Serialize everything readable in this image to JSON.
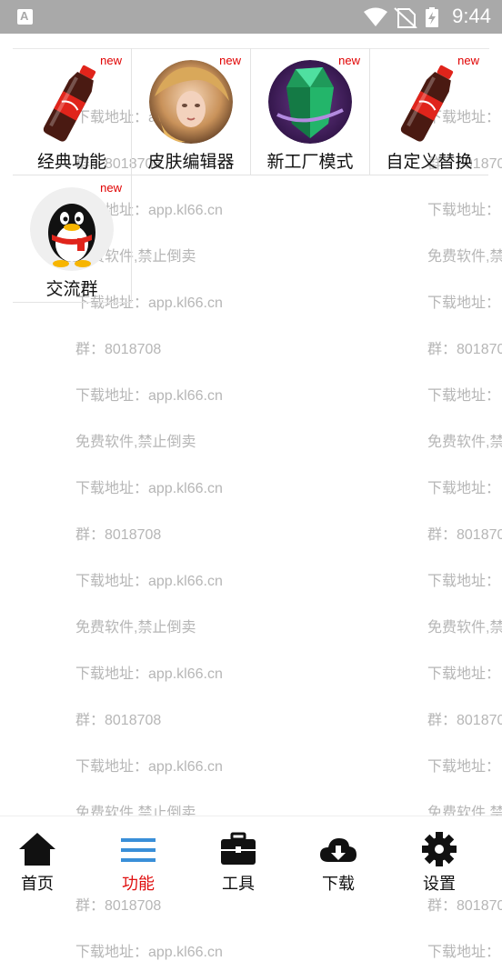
{
  "status_bar": {
    "time": "9:44",
    "icons": [
      "app-launcher-icon",
      "wifi-icon",
      "no-sim-icon",
      "battery-charging-icon"
    ]
  },
  "watermark": {
    "left_texts": [
      "下载地址：app.kl66.cn",
      "群：8018708",
      "下载地址：app.kl66.cn",
      "免费软件,禁止倒卖",
      "下载地址：app.kl66.cn",
      "群：8018708",
      "下载地址：app.kl66.cn",
      "免费软件,禁止倒卖",
      "下载地址：app.kl66.cn",
      "群：8018708",
      "下载地址：app.kl66.cn",
      "免费软件,禁止倒卖",
      "下载地址：app.kl66.cn",
      "群：8018708",
      "下载地址：app.kl66.cn",
      "免费软件,禁止倒卖",
      "下载地址：app.kl66.cn",
      "群：8018708",
      "下载地址：app.kl66.cn"
    ],
    "right_texts": [
      "下载地址：",
      "群：801870",
      "下载地址：",
      "免费软件,禁",
      "下载地址：",
      "群：801870",
      "下载地址：",
      "免费软件,禁",
      "下载地址：",
      "群：801870",
      "下载地址：",
      "免费软件,禁",
      "下载地址：",
      "群：801870",
      "下载地址：",
      "免费软件,禁",
      "下载地址：",
      "群：801870",
      "下载地址："
    ]
  },
  "features": [
    {
      "label": "经典功能",
      "badge": "new",
      "icon": "cola-bottle-icon"
    },
    {
      "label": "皮肤编辑器",
      "badge": "new",
      "icon": "hero-portrait-icon"
    },
    {
      "label": "新工厂模式",
      "badge": "new",
      "icon": "green-crystal-icon"
    },
    {
      "label": "自定义替换",
      "badge": "new",
      "icon": "cola-bottle-icon"
    },
    {
      "label": "交流群",
      "badge": "new",
      "icon": "qq-penguin-icon"
    }
  ],
  "tabbar": {
    "items": [
      {
        "label": "首页",
        "icon": "home-icon",
        "active": false
      },
      {
        "label": "功能",
        "icon": "menu-lines-icon",
        "active": true
      },
      {
        "label": "工具",
        "icon": "toolbox-icon",
        "active": false
      },
      {
        "label": "下载",
        "icon": "cloud-download-icon",
        "active": false
      },
      {
        "label": "设置",
        "icon": "gear-icon",
        "active": false
      }
    ],
    "active_color": "#e01010",
    "accent_blue": "#3a8fd8"
  }
}
